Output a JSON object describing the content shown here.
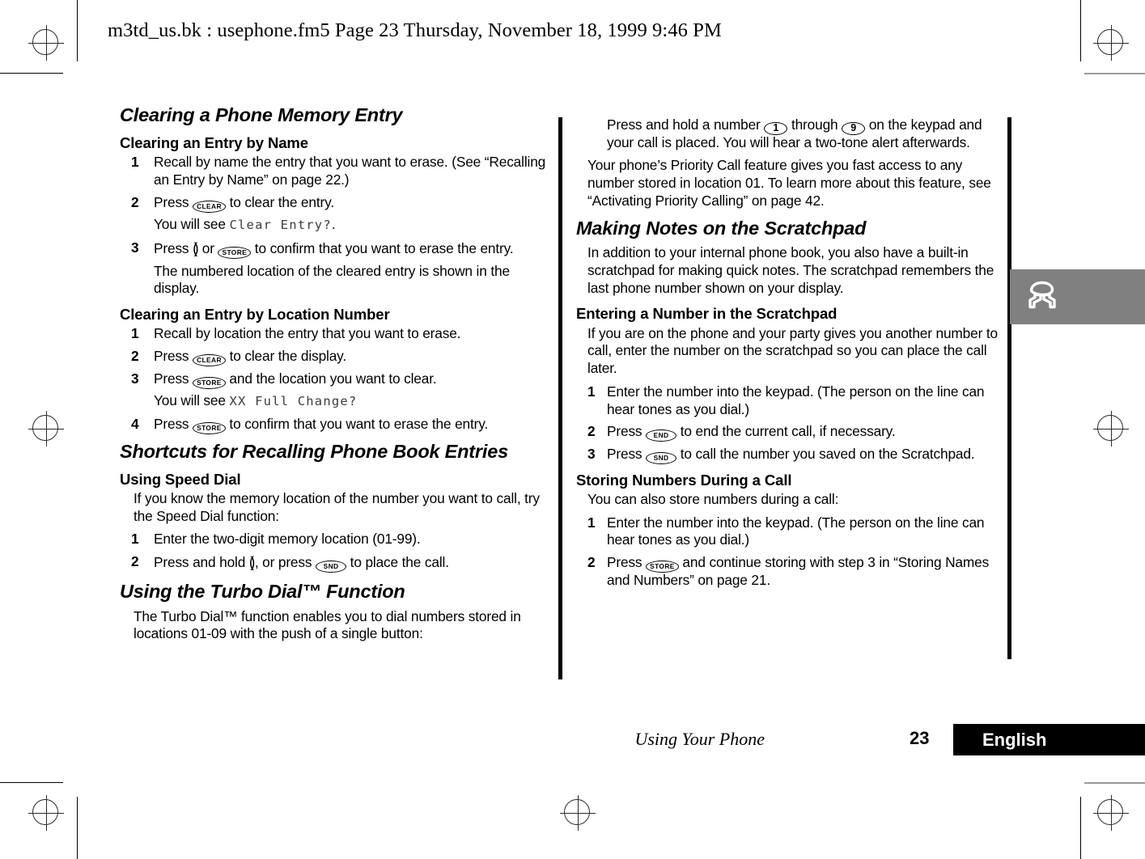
{
  "header": {
    "text": "m3td_us.bk : usephone.fm5  Page 23  Thursday, November 18, 1999  9:46 PM"
  },
  "left_column": {
    "section_title": "Clearing a Phone Memory Entry",
    "sub1": {
      "heading": "Clearing an Entry by Name",
      "steps": [
        {
          "num": "1",
          "text": "Recall by name the entry that you want to erase. (See “Recalling an Entry by Name” on page 22.)"
        },
        {
          "num": "2",
          "pre": "Press ",
          "key": "CLEAR",
          "post": " to clear the entry."
        },
        {
          "num": "3",
          "pre": "Press ",
          "glyph": "()",
          "mid": " or ",
          "key": "STORE",
          "post": " to confirm that you want to erase the entry."
        }
      ],
      "note_after_2_pre": "You will see ",
      "note_after_2_lcd": "Clear Entry?",
      "note_after_2_post": ".",
      "note_after_3": "The numbered location of the cleared entry is shown in the display."
    },
    "sub2": {
      "heading": "Clearing an Entry by Location Number",
      "steps": [
        {
          "num": "1",
          "text": "Recall by location the entry that you want to erase."
        },
        {
          "num": "2",
          "pre": "Press ",
          "key": "CLEAR",
          "post": " to clear the display."
        },
        {
          "num": "3",
          "pre": "Press ",
          "key": "STORE",
          "post": " and the location you want to clear."
        },
        {
          "num": "4",
          "pre": "Press ",
          "key": "STORE",
          "post": " to confirm that you want to erase the entry."
        }
      ],
      "note_after_3_pre": "You will see ",
      "note_after_3_lcd": "XX Full Change?"
    },
    "section_title2": "Shortcuts for Recalling Phone Book Entries",
    "sub3": {
      "heading": "Using Speed Dial",
      "intro": "If you know the memory location of the number you want to call, try the Speed Dial function:",
      "steps": [
        {
          "num": "1",
          "text": "Enter the two-digit memory location (01-99)."
        },
        {
          "num": "2",
          "pre": "Press and hold ",
          "glyph": "()",
          "mid": ", or press ",
          "key": "SND",
          "post": " to place the call."
        }
      ]
    },
    "section_title3": "Using the Turbo Dial™ Function",
    "sub4": {
      "intro": "The Turbo Dial™ function enables you to dial numbers stored in locations 01-09 with the push of a single button:"
    }
  },
  "right_column": {
    "continued_pre": "Press and hold a number ",
    "continued_key1": "1",
    "continued_mid": " through ",
    "continued_key2": "9",
    "continued_post": " on the keypad and your call is placed. You will hear a two-tone alert afterwards.",
    "priority_para": "Your phone’s Priority Call feature gives you fast access to any number stored in location 01. To learn more about this feature, see “Activating Priority Calling” on page 42.",
    "section_title": "Making Notes on the Scratchpad",
    "section_intro": "In addition to your internal phone book, you also have a built-in scratchpad for making quick notes. The scratchpad remembers the last phone number shown on your display.",
    "sub1": {
      "heading": "Entering a Number in the Scratchpad",
      "intro": "If you are on the phone and your party gives you another number to call, enter the number on the scratchpad so you can place the call later.",
      "steps": [
        {
          "num": "1",
          "text": "Enter the number into the keypad. (The person on the line can hear tones as you dial.)"
        },
        {
          "num": "2",
          "pre": "Press ",
          "key": "END",
          "post": " to end the current call, if necessary."
        },
        {
          "num": "3",
          "pre": "Press ",
          "key": "SND",
          "post": " to call the number you saved on the Scratchpad."
        }
      ]
    },
    "sub2": {
      "heading": "Storing Numbers During a Call",
      "intro": "You can also store numbers during a call:",
      "steps": [
        {
          "num": "1",
          "text": "Enter the number into the keypad. (The person on the line can hear tones as you dial.)"
        },
        {
          "num": "2",
          "pre": "Press ",
          "key": "STORE",
          "post": " and continue storing with step 3 in “Storing Names and Numbers” on page 21."
        }
      ]
    }
  },
  "side_tab": {
    "icon": "telephone-icon",
    "color": "#808080"
  },
  "footer": {
    "running_head": "Using Your Phone",
    "page_number": "23",
    "language": "English",
    "bar_color": "#000000"
  }
}
